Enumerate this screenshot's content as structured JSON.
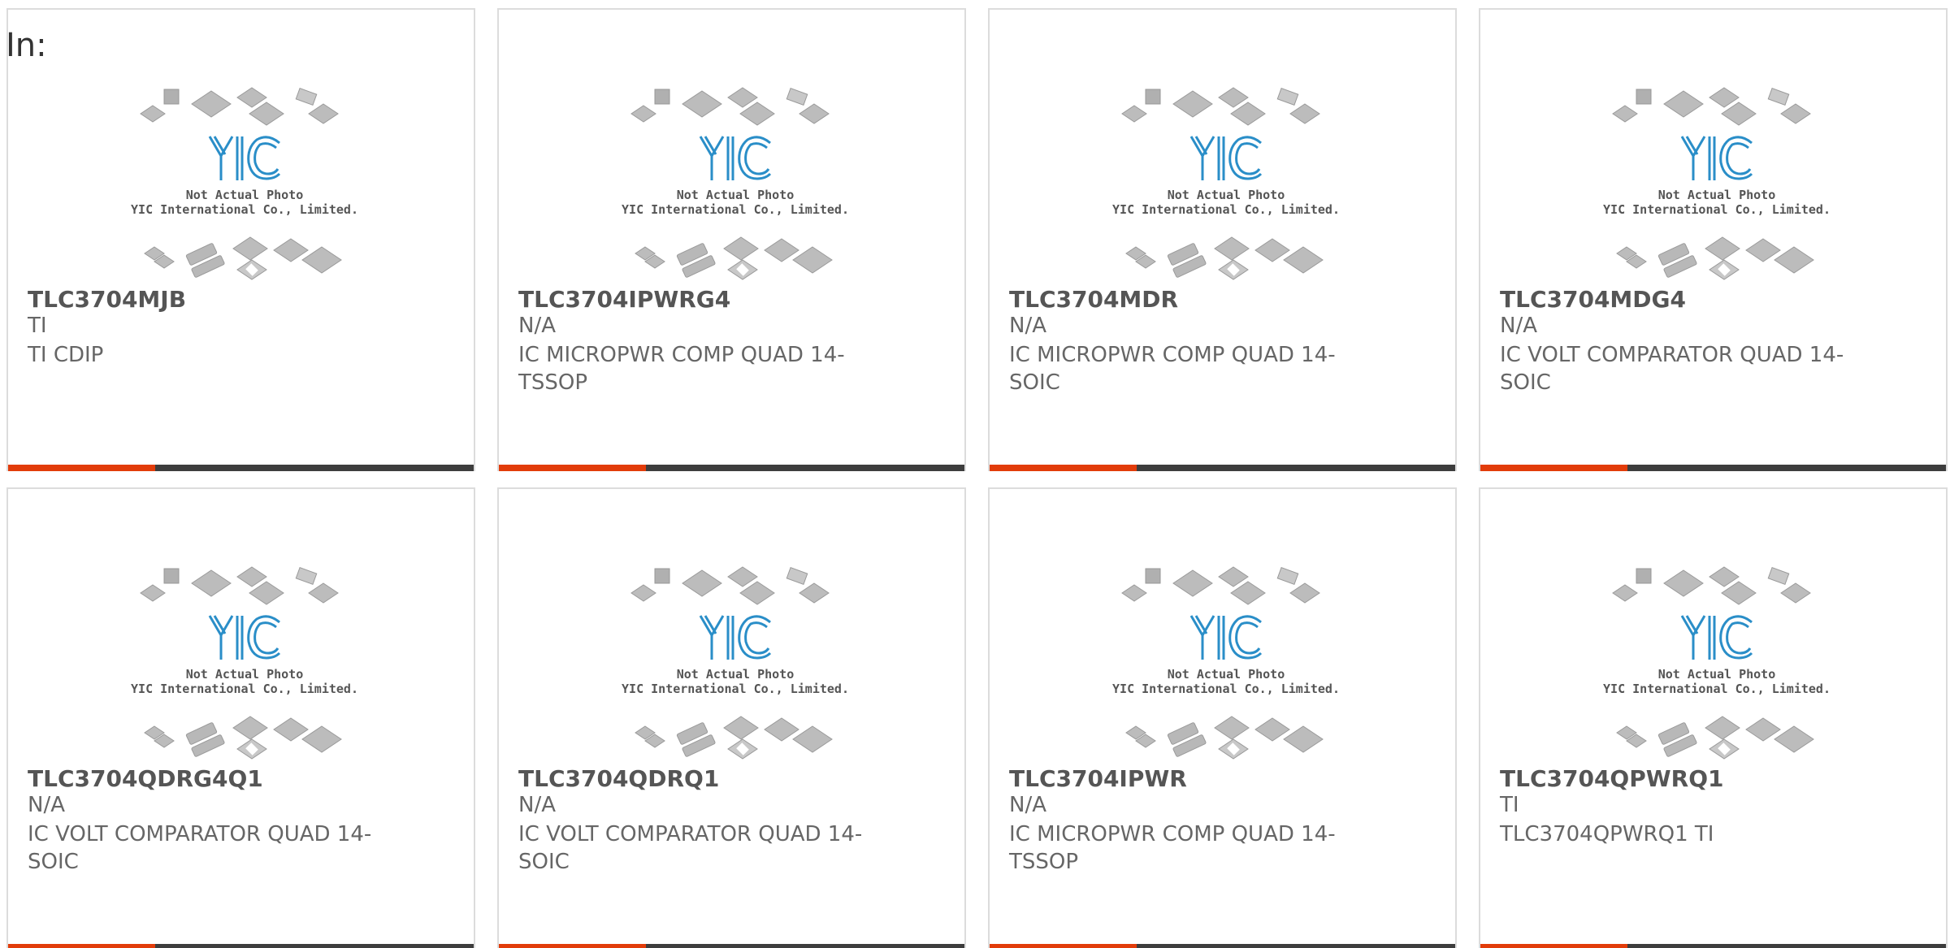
{
  "header": {
    "in_label": "In:"
  },
  "placeholder_image": {
    "logo_text": "YIC",
    "line1": "Not Actual Photo",
    "line2": "YIC International Co., Limited."
  },
  "colors": {
    "accent": "#e23c0a",
    "bar": "#3d3d3d",
    "logo": "#2a8ec8"
  },
  "products": [
    {
      "part": "TLC3704MJB",
      "maker": "TI",
      "desc": "TI CDIP"
    },
    {
      "part": "TLC3704IPWRG4",
      "maker": "N/A",
      "desc": "IC MICROPWR COMP QUAD 14-TSSOP"
    },
    {
      "part": "TLC3704MDR",
      "maker": "N/A",
      "desc": "IC MICROPWR COMP QUAD 14-SOIC"
    },
    {
      "part": "TLC3704MDG4",
      "maker": "N/A",
      "desc": "IC VOLT COMPARATOR QUAD 14-SOIC"
    },
    {
      "part": "TLC3704QDRG4Q1",
      "maker": "N/A",
      "desc": "IC VOLT COMPARATOR QUAD 14-SOIC"
    },
    {
      "part": "TLC3704QDRQ1",
      "maker": "N/A",
      "desc": "IC VOLT COMPARATOR QUAD 14-SOIC"
    },
    {
      "part": "TLC3704IPWR",
      "maker": "N/A",
      "desc": "IC MICROPWR COMP QUAD 14-TSSOP"
    },
    {
      "part": "TLC3704QPWRQ1",
      "maker": "TI",
      "desc": "TLC3704QPWRQ1 TI"
    }
  ]
}
